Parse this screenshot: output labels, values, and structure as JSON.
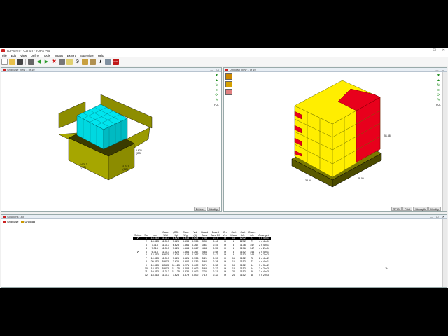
{
  "window": {
    "title": "TOPS Pro - Carton - TOPS Pro"
  },
  "menu": [
    "File",
    "Edit",
    "View",
    "Define",
    "Tools",
    "Import",
    "Export",
    "Supervisor",
    "Help"
  ],
  "toolbar_icons": [
    "new-icon",
    "open-icon",
    "save-icon",
    "print-icon",
    "arrow-left-icon",
    "arrow-right-icon",
    "delete-icon",
    "copy-icon",
    "chart-icon",
    "settings-icon",
    "palette-icon",
    "calculator-icon",
    "info-icon",
    "image-icon",
    "pdf-icon"
  ],
  "toolbar_pdf_label": "PDF",
  "toolbar_info_label": "i",
  "left_pane": {
    "title": "Shipcase View  1 of 10",
    "dims": {
      "w": "14.313\n(OD)",
      "l": "11.313\n(OD)",
      "h": "6.625\n(OD)"
    },
    "buttons": {
      "divider": "Divider",
      "modify": "Modify"
    },
    "side_tools": [
      "arrow-down-icon",
      "arrow-up-icon",
      "refresh-icon",
      "lines-icon",
      "cycle-icon",
      "pencil-icon"
    ],
    "side_label": "FUL"
  },
  "right_pane": {
    "title": "Unitload View  1 of 10",
    "dims": {
      "h": "51.38",
      "w": "38.94",
      "l": "48.00"
    },
    "buttons": {
      "rfid": "RFID",
      "print": "Print",
      "strength": "Strength",
      "modify": "Modify"
    },
    "side_tools": [
      "arrow-down-icon",
      "arrow-up-icon",
      "refresh-icon",
      "lines-icon",
      "cycle-icon",
      "pencil-icon"
    ],
    "side_label": "FUL"
  },
  "bottom_pane": {
    "title": "Solutions List",
    "tabs": [
      "Shipcase",
      "Unitload"
    ],
    "columns": [
      "Select",
      "Sol",
      "Len",
      "Case\nWid",
      "(OD)\nHgt",
      "Case\nWgt",
      "Vol\n(ft)",
      "Board\nArea",
      "Board\nArea Eff",
      "Orn\nVert",
      "Cart\n/Case",
      "Cart\n/UL",
      "Cases\n/UL",
      "Arrangmt"
    ],
    "rows": [
      {
        "sel": "✔",
        "cells": [
          "1",
          "14.313",
          "11.313",
          "6.625",
          "6.916",
          "0.624",
          "7.45",
          "0.47",
          "H",
          "16",
          "1232",
          "77",
          "4 x 4 x 1"
        ],
        "highlight": true
      },
      {
        "sel": "",
        "cells": [
          "2",
          "14.313",
          "11.313",
          "7.625",
          "3.638",
          "0.536",
          "3.39",
          "0.46",
          "H",
          "8",
          "1232",
          "77",
          "4 x 4 x 1"
        ],
        "highlight": false
      },
      {
        "sel": "",
        "cells": [
          "3",
          "7.313",
          "11.313",
          "6.625",
          "1.661",
          "0.267",
          "3.61",
          "0.45",
          "H",
          "8",
          "1176",
          "147",
          "2 x 4 x 1"
        ],
        "highlight": false
      },
      {
        "sel": "",
        "cells": [
          "4",
          "7.313",
          "11.313",
          "7.625",
          "1.664",
          "0.267",
          "4.64",
          "0.55",
          "H",
          "8",
          "1176",
          "147",
          "4 x 2 x 1"
        ],
        "highlight": false
      },
      {
        "sel": "✔",
        "cells": [
          "5",
          "6.313",
          "11.313",
          "7.625",
          "1.664",
          "0.267",
          "4.64",
          "0.58",
          "H",
          "8",
          "1152",
          "144",
          "2 x 4 x 1"
        ],
        "highlight": false
      },
      {
        "sel": "",
        "cells": [
          "6",
          "12.313",
          "6.813",
          "7.625",
          "1.518",
          "0.267",
          "3.38",
          "0.42",
          "H",
          "8",
          "1152",
          "144",
          "2 x 2 x 2"
        ],
        "highlight": false
      },
      {
        "sel": "",
        "cells": [
          "7",
          "10.313",
          "11.313",
          "7.625",
          "3.621",
          "0.536",
          "5.21",
          "0.39",
          "H",
          "16",
          "1152",
          "72",
          "2 x 4 x 2"
        ],
        "highlight": false
      },
      {
        "sel": "",
        "cells": [
          "8",
          "20.313",
          "5.813",
          "7.625",
          "2.902",
          "0.536",
          "5.62",
          "0.38",
          "H",
          "16",
          "1152",
          "72",
          "4 x 4 x 1"
        ],
        "highlight": false
      },
      {
        "sel": "",
        "cells": [
          "9",
          "10.313",
          "8.563",
          "11.125",
          "3.271",
          "0.602",
          "5.71",
          "0.32",
          "H",
          "18",
          "1152",
          "64",
          "3 x 3 x 2"
        ],
        "highlight": false
      },
      {
        "sel": "",
        "cells": [
          "10",
          "18.313",
          "5.813",
          "11.125",
          "3.208",
          "0.602",
          "5.68",
          "0.32",
          "H",
          "18",
          "1152",
          "64",
          "3 x 2 x 3"
        ],
        "highlight": false
      },
      {
        "sel": "",
        "cells": [
          "11",
          "10.313",
          "11.313",
          "11.125",
          "4.336",
          "0.802",
          "7.36",
          "0.31",
          "H",
          "24",
          "1152",
          "48",
          "2 x 4 x 3"
        ],
        "highlight": false
      },
      {
        "sel": "",
        "cells": [
          "12",
          "18.313",
          "11.313",
          "7.625",
          "4.379",
          "0.802",
          "7.19",
          "0.32",
          "H",
          "24",
          "1152",
          "48",
          "4 x 2 x 3"
        ],
        "highlight": false
      }
    ]
  },
  "colors": {
    "case_top": "#00e5ee",
    "case_side": "#00c7d0",
    "carton": "#a6a600",
    "carton_dark": "#7d7d00",
    "ul_yellow": "#ffee00",
    "ul_red": "#e8001c",
    "pallet": "#6b6b00"
  }
}
